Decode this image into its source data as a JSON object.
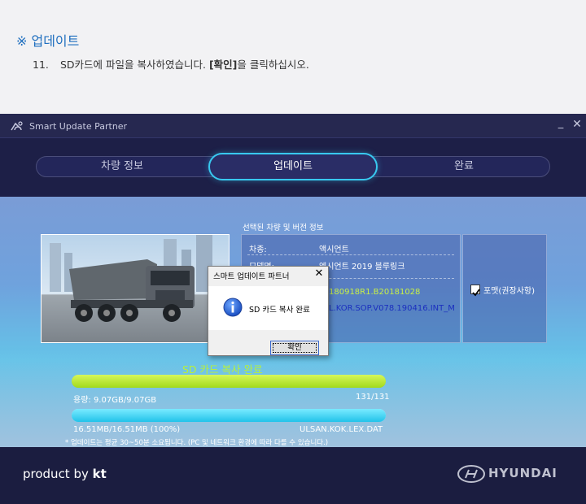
{
  "doc": {
    "heading": "※ 업데이트",
    "step_number": "11.",
    "step_text_before": "SD카드에 파일을 복사하였습니다. ",
    "step_bold": "[확인]",
    "step_text_after": "을 클릭하십시오."
  },
  "app": {
    "title": "Smart Update Partner",
    "minimize": "_",
    "close": "✕",
    "steps": [
      {
        "label": "차량 정보"
      },
      {
        "label": "업데이트"
      },
      {
        "label": "완료"
      }
    ],
    "active_step": 1
  },
  "vehicle": {
    "section_label": "선택된 차량 및 버전 정보",
    "rows": [
      {
        "key": "차종:",
        "value": "액시언트"
      },
      {
        "key": "모델명:",
        "value": "엑시언트 2019 블루링크"
      },
      {
        "key": "",
        "value": "180918R1.B20181028"
      },
      {
        "key": "",
        "value": "L.KOR.SOP.V078.190416.INT_M"
      }
    ],
    "option_label": "포맷(권장사항)",
    "option_checked": true
  },
  "dialog": {
    "title": "스마트 업데이트 파트너",
    "close": "✕",
    "message": "SD 카드 복사 완료",
    "ok_label": "확인",
    "icon": "info-icon"
  },
  "progress": {
    "title": "SD 카드 복사 완료",
    "capacity_text": "용량: 9.07GB/9.07GB",
    "file_count": "131/131",
    "capacity_fraction": 1.0,
    "size_text": "16.51MB/16.51MB (100%)",
    "filename": "ULSAN.KOK.LEX.DAT",
    "file_fraction": 1.0,
    "note": "* 업데이트는 평균 30~50분 소요됩니다. (PC 및 네트워크 환경에 따라 다를 수 있습니다.)"
  },
  "footer": {
    "product_by": "product by ",
    "brand": "kt",
    "partner": "HYUNDAI"
  },
  "colors": {
    "accent": "#38c8ef",
    "bar1": "#b8f03a",
    "bar2": "#22c3ea",
    "doc_heading": "#1f6fbf"
  }
}
